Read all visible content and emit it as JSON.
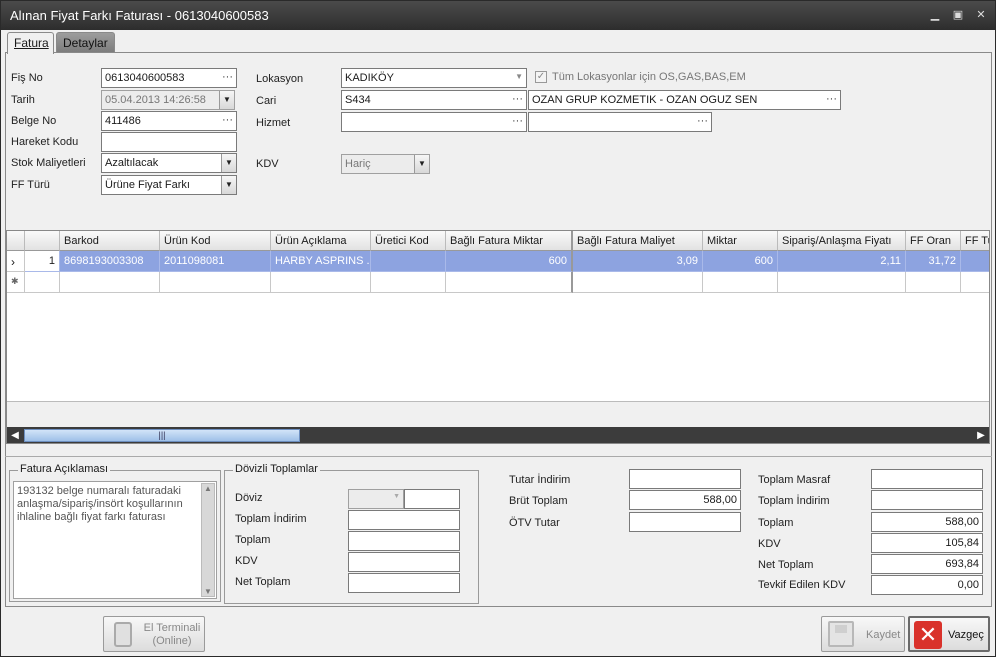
{
  "window": {
    "title": "Alınan Fiyat Farkı Faturası - 0613040600583",
    "minimize": "▁",
    "maximize": "▣",
    "close": "✕"
  },
  "tabs": [
    {
      "label": "Fatura"
    },
    {
      "label": "Detaylar"
    }
  ],
  "header": {
    "fis_no_label": "Fiş No",
    "fis_no": "0613040600583",
    "tarih_label": "Tarih",
    "tarih": "05.04.2013 14:26:58",
    "belge_no_label": "Belge No",
    "belge_no": "411486",
    "hareket_kodu_label": "Hareket Kodu",
    "hareket_kodu": "",
    "stok_maliyetleri_label": "Stok Maliyetleri",
    "stok_maliyetleri": "Azaltılacak",
    "ff_turu_label": "FF Türü",
    "ff_turu": "Ürüne Fiyat Farkı",
    "lokasyon_label": "Lokasyon",
    "lokasyon": "KADIKÖY",
    "tum_lokasyon_label": "Tüm Lokasyonlar için OS,GAS,BAS,EM",
    "tum_lokasyon_checked": "✓",
    "cari_label": "Cari",
    "cari_kod": "S434",
    "cari_ad": "OZAN GRUP  KOZMETIK - OZAN OGUZ SEN",
    "hizmet_label": "Hizmet",
    "hizmet_kod": "",
    "hizmet_ad": "",
    "kdv_label": "KDV",
    "kdv": "Hariç",
    "dots": "···",
    "dropdown_icon": "▼"
  },
  "grid": {
    "columns": [
      "Barkod",
      "Ürün Kod",
      "Ürün Açıklama",
      "Üretici Kod",
      "Bağlı Fatura Miktar",
      "Bağlı Fatura Maliyet",
      "Miktar",
      "Sipariş/Anlaşma Fiyatı",
      "FF Oran",
      "FF Tu"
    ],
    "rows": [
      {
        "indicator": "›",
        "no": "1",
        "cells": [
          "8698193003308",
          "2011098081",
          "HARBY ASPRINS ...",
          "",
          "600",
          "3,09",
          "600",
          "2,11",
          "31,72",
          ""
        ]
      }
    ],
    "new_row_indicator": "✱",
    "scroll_thumb_grip": "|||",
    "scroll_left": "◀",
    "scroll_right": "▶"
  },
  "fatura_aciklamasi": {
    "title": "Fatura Açıklaması",
    "text": "193132 belge numaralı faturadaki anlaşma/sipariş/insört koşullarının ihlaline bağlı fiyat farkı faturası",
    "scroll_up": "▲",
    "scroll_down": "▼"
  },
  "dovizli": {
    "title": "Dövizli Toplamlar",
    "doviz_label": "Döviz",
    "doviz": "",
    "doviz_kur": "",
    "toplam_indirim_label": "Toplam İndirim",
    "toplam_indirim": "",
    "toplam_label": "Toplam",
    "toplam": "",
    "kdv_label": "KDV",
    "kdv": "",
    "net_toplam_label": "Net Toplam",
    "net_toplam": ""
  },
  "totals_mid": {
    "tutar_indirim_label": "Tutar İndirim",
    "tutar_indirim": "",
    "brut_toplam_label": "Brüt Toplam",
    "brut_toplam": "588,00",
    "otv_tutar_label": "ÖTV Tutar",
    "otv_tutar": ""
  },
  "totals_right": {
    "toplam_masraf_label": "Toplam Masraf",
    "toplam_masraf": "",
    "toplam_indirim_label": "Toplam İndirim",
    "toplam_indirim": "",
    "toplam_label": "Toplam",
    "toplam": "588,00",
    "kdv_label": "KDV",
    "kdv": "105,84",
    "net_toplam_label": "Net Toplam",
    "net_toplam": "693,84",
    "tevkif_label": "Tevkif Edilen KDV",
    "tevkif": "0,00"
  },
  "buttons": {
    "el_terminali_line1": "El Terminali",
    "el_terminali_line2": "(Online)",
    "kaydet": "Kaydet",
    "vazgec": "Vazgeç"
  },
  "colors": {
    "selection": "#8da3e0",
    "titlebar": "#3a3a3a",
    "vazgec_icon": "#d9322b"
  }
}
